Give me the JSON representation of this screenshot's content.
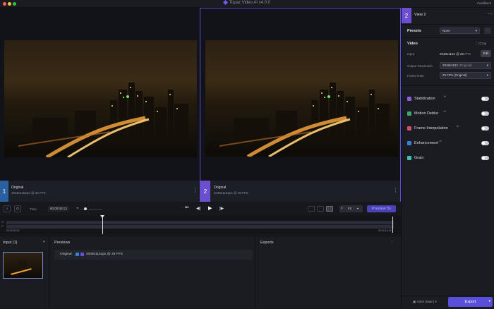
{
  "app": {
    "title": "Topaz Video AI  v4.0.0",
    "feedback": "Feedback"
  },
  "views": {
    "left": {
      "number": "1",
      "title": "Original",
      "meta": "2048x1152px @ 25 FPS"
    },
    "right": {
      "number": "2",
      "title": "Original",
      "meta": "2048x1152px @ 25 FPS"
    }
  },
  "transport": {
    "mark_in": "I",
    "mark_out": "O",
    "time_label": "Time",
    "time_value": "00:00:00:13",
    "zoom": "Fit",
    "preview_button": "Preview 5s"
  },
  "timeline": {
    "start": "00:00:00:00",
    "end": "00:00:14:19",
    "track_labels": [
      "O",
      "P"
    ]
  },
  "panel": {
    "view_number": "2",
    "view_title": "View 2",
    "presets_label": "Presets",
    "presets_value": "None",
    "video_label": "Video",
    "crop_label": "Crop",
    "input_label": "Input",
    "input_value": "2048x1152",
    "input_fps": "25",
    "input_fps_unit": "FPS",
    "edit_button": "Edit",
    "output_res_label": "Output Resolution",
    "output_res_value": "2048x1152",
    "output_res_note": "(Original)",
    "frame_rate_label": "Frame Rate",
    "frame_rate_value": "25 FPS (Original)",
    "filters": [
      {
        "label": "Stabilization",
        "sup": "AI",
        "color": "#8f5bd9",
        "enabled": false
      },
      {
        "label": "Motion Deblur",
        "sup": "AI",
        "color": "#3fa66b",
        "enabled": false
      },
      {
        "label": "Frame Interpolation",
        "sup": "AI",
        "color": "#d44d6e",
        "enabled": false
      },
      {
        "label": "Enhancement",
        "sup": "AI",
        "color": "#3a7fd4",
        "enabled": false
      },
      {
        "label": "Grain",
        "sup": "",
        "color": "#3fbfb0",
        "enabled": false
      }
    ],
    "format": "H264 (Main)",
    "export_button": "Export"
  },
  "input": {
    "title": "Input (1)"
  },
  "previews": {
    "title": "Previews",
    "row_label": "Original",
    "row_meta": "2048x1152px @ 25 FPS"
  },
  "exports": {
    "title": "Exports"
  },
  "colors": {
    "accent": "#6b5ce7",
    "view1": "#3a7fd4",
    "view2": "#6b4fd0",
    "panel_bg": "#1b1c22"
  }
}
